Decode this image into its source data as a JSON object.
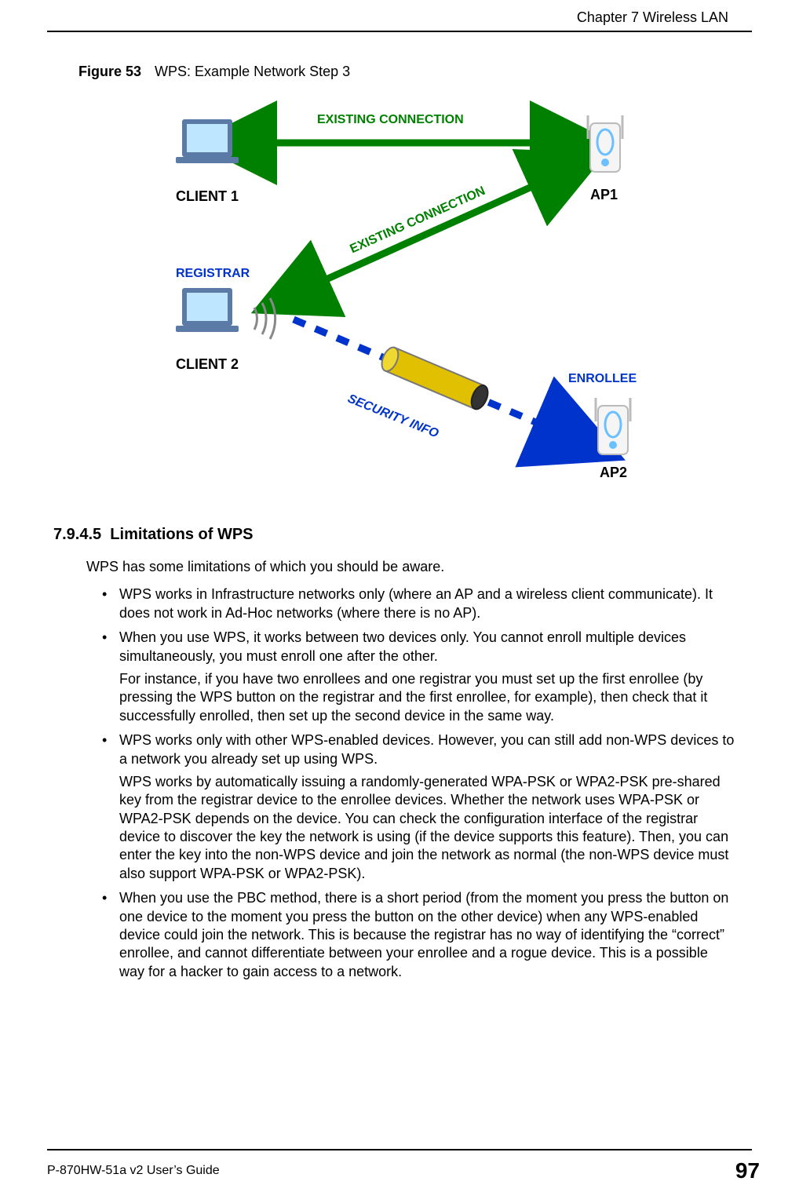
{
  "chapter_header": "Chapter 7 Wireless LAN",
  "figure": {
    "label": "Figure 53",
    "caption": "WPS: Example Network Step 3",
    "labels": {
      "existing_connection_top": "EXISTING CONNECTION",
      "existing_connection_diag": "EXISTING CONNECTION",
      "client1": "CLIENT 1",
      "ap1": "AP1",
      "registrar": "REGISTRAR",
      "client2": "CLIENT 2",
      "security_info": "SECURITY INFO",
      "enrollee": "ENROLLEE",
      "ap2": "AP2"
    }
  },
  "section": {
    "number": "7.9.4.5",
    "title": "Limitations of WPS",
    "intro": "WPS has some limitations of which you should be aware.",
    "bullets": [
      {
        "text": "WPS works in Infrastructure networks only (where an AP and a wireless client communicate). It does not work in Ad-Hoc networks (where there is no AP)."
      },
      {
        "text": "When you use WPS, it works between two devices only. You cannot enroll multiple devices simultaneously, you must enroll one after the other.",
        "sub": "For instance, if you have two enrollees and one registrar you must set up the first enrollee (by pressing the WPS button on the registrar and the first enrollee, for example), then check that it successfully enrolled, then set up the second device in the same way."
      },
      {
        "text": "WPS works only with other WPS-enabled devices. However, you can still add non-WPS devices to a network you already set up using WPS.",
        "sub": "WPS works by automatically issuing a randomly-generated WPA-PSK or WPA2-PSK pre-shared key from the registrar device to the enrollee devices. Whether the network uses WPA-PSK or WPA2-PSK depends on the device. You can check the configuration interface of the registrar device to discover the key the network is using (if the device supports this feature). Then, you can enter the key into the non-WPS device and join the network as normal (the non-WPS device must also support WPA-PSK or WPA2-PSK)."
      },
      {
        "text": "When you use the PBC method, there is a short period (from the moment you press the button on one device to the moment you press the button on the other device) when any WPS-enabled device could join the network. This is because the registrar has no way of identifying the “correct” enrollee, and cannot differentiate between your enrollee and a rogue device. This is a possible way for a hacker to gain access to a network."
      }
    ]
  },
  "footer": {
    "guide": "P-870HW-51a v2 User’s Guide",
    "page": "97"
  }
}
